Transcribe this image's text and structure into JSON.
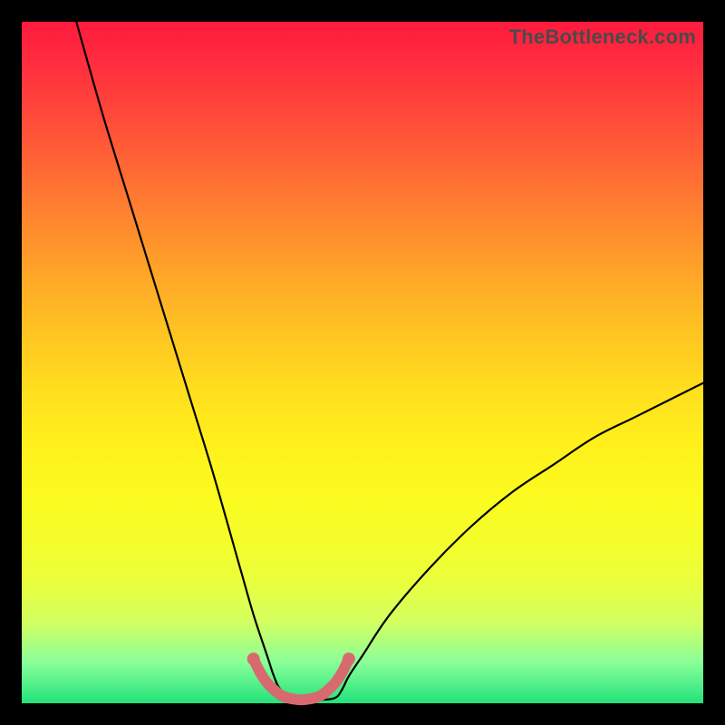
{
  "attribution": "TheBottleneck.com",
  "chart_data": {
    "type": "line",
    "title": "",
    "xlabel": "",
    "ylabel": "",
    "xlim": [
      0,
      100
    ],
    "ylim": [
      0,
      100
    ],
    "note": "Bottleneck curve: V-shape reaching ~0 near x≈38–46; both branches rise steeply away from the minimum. Left branch reaches ~100 at x≈8; right branch reaches ~47 at x≈100.",
    "series": [
      {
        "name": "main-curve",
        "x": [
          8,
          12,
          16,
          20,
          24,
          28,
          32,
          34,
          36,
          37,
          38,
          40,
          42,
          44,
          46,
          47,
          48,
          50,
          54,
          60,
          66,
          72,
          78,
          84,
          90,
          96,
          100
        ],
        "y": [
          100,
          86,
          73,
          60,
          47,
          34,
          20,
          13,
          7,
          4,
          2,
          0.8,
          0.5,
          0.5,
          0.8,
          2,
          4,
          7,
          13,
          20,
          26,
          31,
          35,
          39,
          42,
          45,
          47
        ]
      },
      {
        "name": "base-marker",
        "x": [
          34,
          35,
          36,
          37,
          38,
          39,
          40,
          41,
          42,
          43,
          44,
          45,
          46,
          47,
          48
        ],
        "y": [
          6.5,
          4.5,
          3,
          2,
          1.2,
          0.8,
          0.6,
          0.5,
          0.6,
          0.8,
          1.2,
          2,
          3,
          4.5,
          6.5
        ]
      }
    ],
    "colors": {
      "curve": "#000000",
      "marker": "#d86a6f",
      "gradient_top": "#ff1a3e",
      "gradient_mid": "#ffe41c",
      "gradient_bottom": "#22e27a",
      "frame": "#000000"
    }
  }
}
